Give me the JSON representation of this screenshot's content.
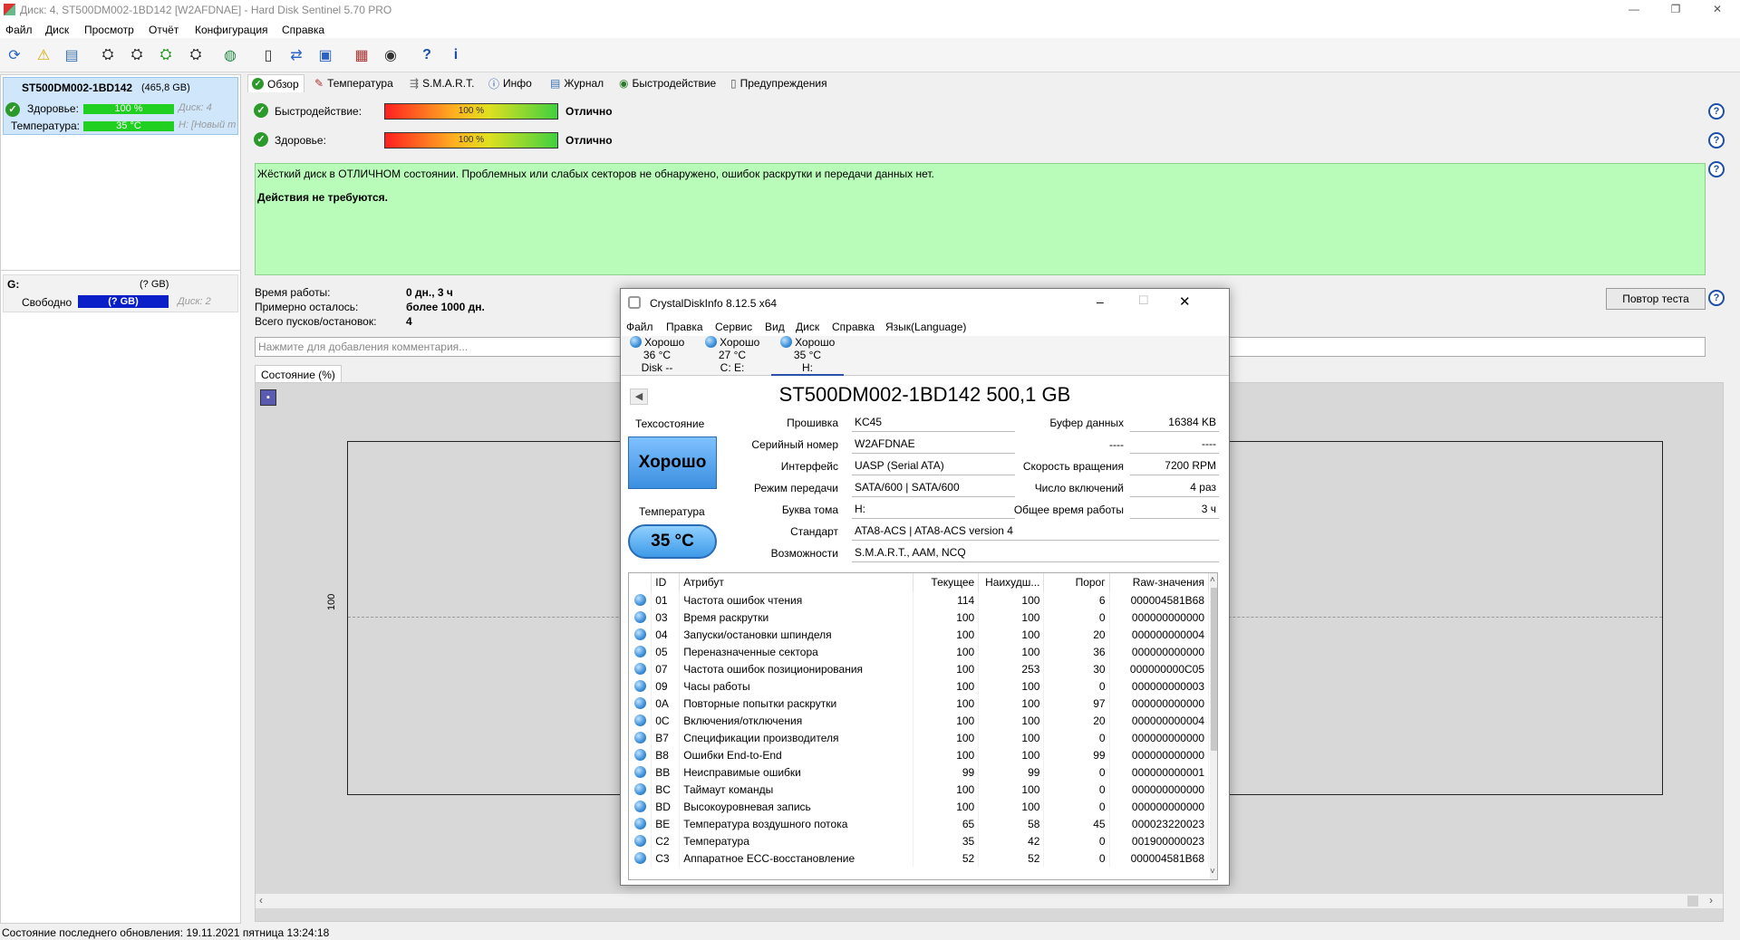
{
  "window": {
    "title": "Диск: 4, ST500DM002-1BD142 [W2AFDNAE]  -  Hard Disk Sentinel 5.70 PRO",
    "minimize": "—",
    "restore": "❐",
    "close": "✕"
  },
  "menu": [
    "Файл",
    "Диск",
    "Просмотр",
    "Отчёт",
    "Конфигурация",
    "Справка"
  ],
  "toolbar_icons": [
    "refresh-icon",
    "warning-icon",
    "report-icon",
    "disk-tool-1-icon",
    "disk-tool-2-icon",
    "disk-tool-3-icon",
    "disk-tool-4-icon",
    "globe-icon",
    "document-icon",
    "sync-icon",
    "network-icon",
    "chart-icon",
    "speaker-icon",
    "help-icon",
    "info-icon"
  ],
  "left": {
    "disk1": {
      "name": "ST500DM002-1BD142",
      "size": "(465,8 GB)",
      "health_label": "Здоровье:",
      "health_value": "100 %",
      "health_disk": "Диск: 4",
      "temp_label": "Температура:",
      "temp_value": "35 °C",
      "temp_extra": "H: [Новый т"
    },
    "volume": {
      "letter": "G:",
      "size": "(? GB)",
      "free_label": "Свободно",
      "free_value": "(? GB)",
      "disk": "Диск: 2"
    }
  },
  "tabs": [
    "Обзор",
    "Температура",
    "S.M.A.R.T.",
    "Инфо",
    "Журнал",
    "Быстродействие",
    "Предупреждения"
  ],
  "overview": {
    "perf_label": "Быстродействие:",
    "perf_value": "100 %",
    "perf_status": "Отлично",
    "perf_percent": 100,
    "health_label": "Здоровье:",
    "health_value": "100 %",
    "health_status": "Отлично",
    "health_percent": 100,
    "message": "Жёсткий диск в ОТЛИЧНОМ состоянии. Проблемных или слабых секторов не обнаружено, ошибок раскрутки и передачи данных нет.",
    "action": "Действия не требуются.",
    "uptime_label": "Время работы:",
    "uptime_value": "0 дн., 3 ч",
    "remaining_label": "Примерно осталось:",
    "remaining_value": "более 1000 дн.",
    "startstop_label": "Всего пусков/остановок:",
    "startstop_value": "4",
    "retest": "Повтор теста",
    "comment_placeholder": "Нажмите для добавления комментария...",
    "state_tab": "Состояние (%)",
    "graph_tick": "100"
  },
  "footer": "Состояние последнего обновления: 19.11.2021 пятница 13:24:18",
  "cdi": {
    "title": "CrystalDiskInfo 8.12.5 x64",
    "menu": [
      "Файл",
      "Правка",
      "Сервис",
      "Вид",
      "Диск",
      "Справка",
      "Язык(Language)"
    ],
    "disks": [
      {
        "status": "Хорошо",
        "temp": "36 °C",
        "label": "Disk --"
      },
      {
        "status": "Хорошо",
        "temp": "27 °C",
        "label": "C: E:"
      },
      {
        "status": "Хорошо",
        "temp": "35 °C",
        "label": "H:"
      }
    ],
    "model": "ST500DM002-1BD142 500,1 GB",
    "health_label": "Техсостояние",
    "health_value": "Хорошо",
    "temp_label": "Температура",
    "temp_value": "35 °C",
    "fields": {
      "firmware_label": "Прошивка",
      "firmware": "KC45",
      "serial_label": "Серийный номер",
      "serial": "W2AFDNAE",
      "interface_label": "Интерфейс",
      "interface": "UASP (Serial ATA)",
      "mode_label": "Режим передачи",
      "mode": "SATA/600 | SATA/600",
      "volume_label": "Буква тома",
      "volume": "H:",
      "standard_label": "Стандарт",
      "standard": "ATA8-ACS | ATA8-ACS version 4",
      "features_label": "Возможности",
      "features": "S.M.A.R.T., AAM, NCQ",
      "buffer_label": "Буфер данных",
      "buffer": "16384 KB",
      "blank_label": "----",
      "blank": "----",
      "rpm_label": "Скорость вращения",
      "rpm": "7200 RPM",
      "power_count_label": "Число включений",
      "power_count": "4 раз",
      "power_hours_label": "Общее время работы",
      "power_hours": "3 ч"
    },
    "columns": [
      "ID",
      "Атрибут",
      "Текущее",
      "Наихудш...",
      "Порог",
      "Raw-значения"
    ],
    "rows": [
      [
        "01",
        "Частота ошибок чтения",
        "114",
        "100",
        "6",
        "000004581B68"
      ],
      [
        "03",
        "Время раскрутки",
        "100",
        "100",
        "0",
        "000000000000"
      ],
      [
        "04",
        "Запуски/остановки шпинделя",
        "100",
        "100",
        "20",
        "000000000004"
      ],
      [
        "05",
        "Переназначенные сектора",
        "100",
        "100",
        "36",
        "000000000000"
      ],
      [
        "07",
        "Частота ошибок позиционирования",
        "100",
        "253",
        "30",
        "000000000C05"
      ],
      [
        "09",
        "Часы работы",
        "100",
        "100",
        "0",
        "000000000003"
      ],
      [
        "0A",
        "Повторные попытки раскрутки",
        "100",
        "100",
        "97",
        "000000000000"
      ],
      [
        "0C",
        "Включения/отключения",
        "100",
        "100",
        "20",
        "000000000004"
      ],
      [
        "B7",
        "Спецификации производителя",
        "100",
        "100",
        "0",
        "000000000000"
      ],
      [
        "B8",
        "Ошибки End-to-End",
        "100",
        "100",
        "99",
        "000000000000"
      ],
      [
        "BB",
        "Неисправимые ошибки",
        "99",
        "99",
        "0",
        "000000000001"
      ],
      [
        "BC",
        "Таймаут команды",
        "100",
        "100",
        "0",
        "000000000000"
      ],
      [
        "BD",
        "Высокоуровневая запись",
        "100",
        "100",
        "0",
        "000000000000"
      ],
      [
        "BE",
        "Температура воздушного потока",
        "65",
        "58",
        "45",
        "000023220023"
      ],
      [
        "C2",
        "Температура",
        "35",
        "42",
        "0",
        "001900000023"
      ],
      [
        "C3",
        "Аппаратное ECC-восстановление",
        "52",
        "52",
        "0",
        "000004581B68"
      ]
    ]
  }
}
